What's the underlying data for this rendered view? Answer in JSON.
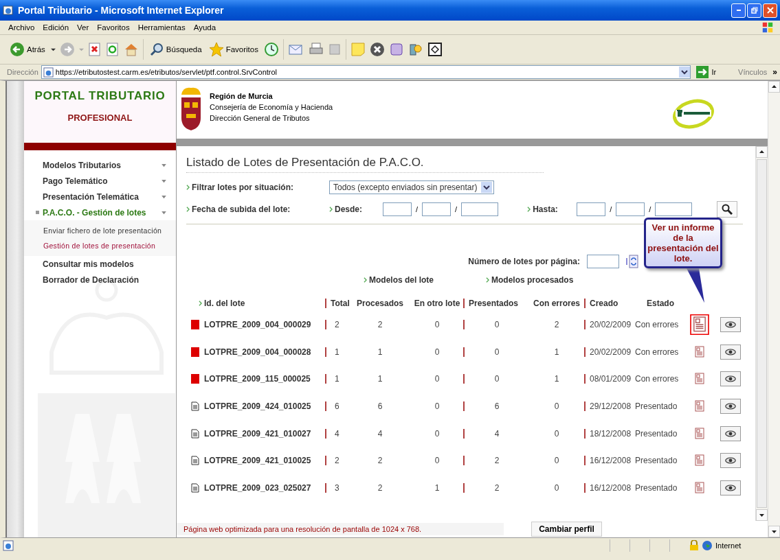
{
  "window": {
    "title": "Portal Tributario - Microsoft Internet Explorer"
  },
  "menu_bar": [
    "Archivo",
    "Edición",
    "Ver",
    "Favoritos",
    "Herramientas",
    "Ayuda"
  ],
  "toolbar": {
    "back": "Atrás",
    "search": "Búsqueda",
    "favorites": "Favoritos"
  },
  "address_bar": {
    "label": "Dirección",
    "value": "https://etributostest.carm.es/etributos/servlet/ptf.control.SrvControl",
    "go": "Ir",
    "links": "Vínculos",
    "more": "»"
  },
  "header": {
    "portal_title": "PORTAL TRIBUTARIO",
    "portal_subtitle": "PROFESIONAL",
    "org_name": "Región de Murcia",
    "org_lines": [
      "Consejería de Economía y Hacienda",
      "Dirección General de Tributos"
    ]
  },
  "sidebar": {
    "items": [
      {
        "kind": "submenu",
        "label": "Modelos Tributarios",
        "selected": false
      },
      {
        "kind": "submenu",
        "label": "Pago Telemático",
        "selected": false
      },
      {
        "kind": "submenu",
        "label": "Presentación Telemática",
        "selected": false
      },
      {
        "kind": "submenu",
        "label": "P.A.C.O. - Gestión de lotes",
        "selected": true,
        "expanded": true,
        "children": [
          {
            "label": "Enviar fichero de lote presentación",
            "selected": false
          },
          {
            "label": "Gestión de lotes de presentación",
            "selected": true
          }
        ]
      },
      {
        "kind": "link",
        "label": "Consultar mis modelos",
        "selected": false
      },
      {
        "kind": "link",
        "label": "Borrador de Declaración",
        "selected": false
      }
    ]
  },
  "content": {
    "title": "Listado de Lotes de Presentación de P.A.C.O.",
    "filter": {
      "label": "Filtrar lotes por situación:",
      "value": "Todos (excepto enviados sin presentar)"
    },
    "date_filter": {
      "label": "Fecha de subida del lote:",
      "from": {
        "label": "Desde:",
        "separators": [
          "/",
          "/"
        ]
      },
      "to": {
        "label": "Hasta:",
        "separators": [
          "/",
          "/"
        ]
      }
    },
    "per_page": {
      "label": "Número de lotes por página:"
    },
    "column_groups": [
      "Modelos del lote",
      "Modelos procesados"
    ],
    "columns": [
      "Id. del lote",
      "Total",
      "Procesados",
      "En otro lote",
      "Presentados",
      "Con errores",
      "Creado",
      "Estado"
    ],
    "rows": [
      {
        "kind": "error",
        "id": "LOTPRE_2009_004_000029",
        "total": "2",
        "processed": "2",
        "other": "0",
        "presented": "0",
        "errors": "2",
        "created": "20/02/2009",
        "status": "Con errores",
        "highlighted": true
      },
      {
        "kind": "error",
        "id": "LOTPRE_2009_004_000028",
        "total": "1",
        "processed": "1",
        "other": "0",
        "presented": "0",
        "errors": "1",
        "created": "20/02/2009",
        "status": "Con errores",
        "highlighted": false
      },
      {
        "kind": "error",
        "id": "LOTPRE_2009_115_000025",
        "total": "1",
        "processed": "1",
        "other": "0",
        "presented": "0",
        "errors": "1",
        "created": "08/01/2009",
        "status": "Con errores",
        "highlighted": false
      },
      {
        "kind": "document",
        "id": "LOTPRE_2009_424_010025",
        "total": "6",
        "processed": "6",
        "other": "0",
        "presented": "6",
        "errors": "0",
        "created": "29/12/2008",
        "status": "Presentado",
        "highlighted": false
      },
      {
        "kind": "document",
        "id": "LOTPRE_2009_421_010027",
        "total": "4",
        "processed": "4",
        "other": "0",
        "presented": "4",
        "errors": "0",
        "created": "18/12/2008",
        "status": "Presentado",
        "highlighted": false
      },
      {
        "kind": "document",
        "id": "LOTPRE_2009_421_010025",
        "total": "2",
        "processed": "2",
        "other": "0",
        "presented": "2",
        "errors": "0",
        "created": "16/12/2008",
        "status": "Presentado",
        "highlighted": false
      },
      {
        "kind": "document",
        "id": "LOTPRE_2009_023_025027",
        "total": "3",
        "processed": "2",
        "other": "1",
        "presented": "2",
        "errors": "0",
        "created": "16/12/2008",
        "status": "Presentado",
        "highlighted": false
      }
    ],
    "tooltip": "Ver un informe de la presentación del  lote.",
    "footer_note": "Página web optimizada para una resolución de pantalla de 1024 x 768.",
    "change_profile": "Cambiar perfil"
  },
  "status_bar": {
    "zone": "Internet"
  }
}
